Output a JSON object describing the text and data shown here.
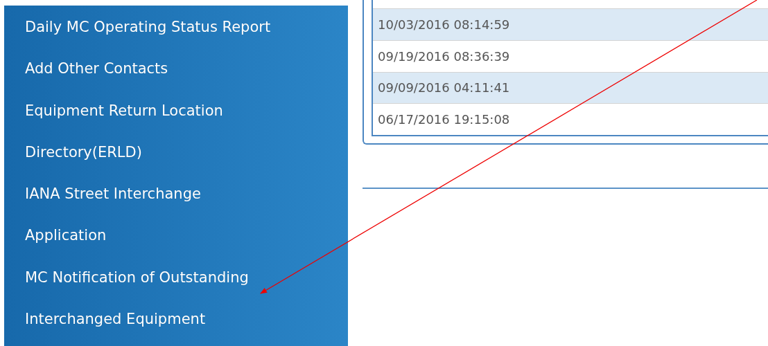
{
  "sidebar": {
    "items": [
      {
        "label": "Daily MC Operating Status Report"
      },
      {
        "label": "Add Other Contacts"
      },
      {
        "label": "Equipment Return Location"
      },
      {
        "label": "Directory(ERLD)"
      },
      {
        "label": "IANA Street Interchange"
      },
      {
        "label": "Application"
      },
      {
        "label": "MC Notification of Outstanding"
      },
      {
        "label": "Interchanged Equipment"
      }
    ]
  },
  "table": {
    "rows": [
      {
        "column_1": "10/03/2016 08:14:59"
      },
      {
        "column_1": "09/19/2016 08:36:39"
      },
      {
        "column_1": "09/09/2016 04:11:41"
      },
      {
        "column_1": "06/17/2016 19:15:08"
      }
    ]
  },
  "annotation": {
    "kind": "arrow"
  }
}
